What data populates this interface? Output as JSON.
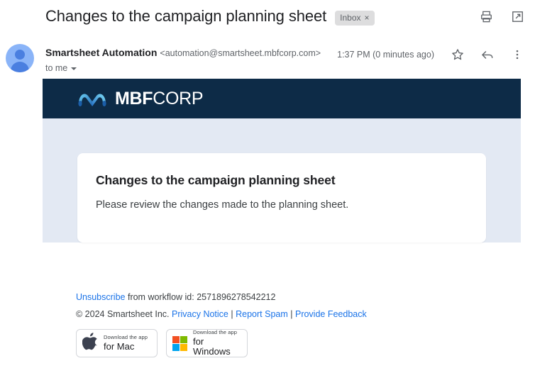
{
  "subject": {
    "title": "Changes to the campaign planning sheet",
    "label": "Inbox",
    "label_close": "×"
  },
  "toolbar": {
    "print": "print-icon",
    "open_in_new": "open-in-new-icon"
  },
  "sender": {
    "name": "Smartsheet Automation",
    "email": "<automation@smartsheet.mbfcorp.com>",
    "recipient": "to me",
    "timestamp": "1:37 PM (0 minutes ago)",
    "star": "star-icon",
    "reply": "reply-icon",
    "more": "more-vert-icon"
  },
  "email": {
    "brand": {
      "bold_part": "MBF",
      "light_part": "CORP",
      "navy": "#0d2b47",
      "accent": "#3fa9f5"
    },
    "panel_bg": "#e3e9f3",
    "card": {
      "heading": "Changes to the campaign planning sheet",
      "body": "Please review the changes made to the planning sheet."
    }
  },
  "footer": {
    "unsubscribe": "Unsubscribe",
    "workflow_text": "from workflow id: 2571896278542212",
    "copyright": "© 2024 Smartsheet Inc.",
    "privacy": "Privacy Notice",
    "report_spam": "Report Spam",
    "feedback": "Provide Feedback",
    "sep1": "|",
    "sep2": "|",
    "badges": [
      {
        "top": "Download the app",
        "bottom": "for Mac",
        "icon": "apple-logo-icon"
      },
      {
        "top": "Download the app",
        "bottom": "for Windows",
        "icon": "windows-logo-icon"
      }
    ],
    "link_color": "#1a73e8"
  }
}
